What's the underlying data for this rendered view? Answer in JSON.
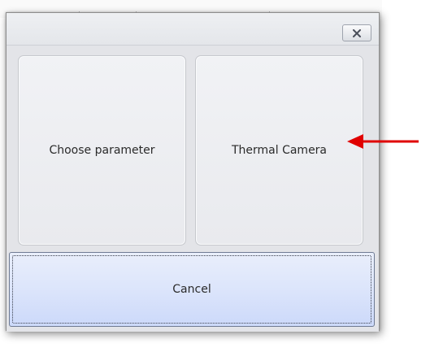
{
  "dialog": {
    "close_icon": "close-x-icon",
    "options": [
      {
        "label": "Choose parameter"
      },
      {
        "label": "Thermal Camera"
      }
    ],
    "cancel_label": "Cancel"
  },
  "annotation": {
    "arrow_color": "#e00000",
    "points_to": "Thermal Camera"
  },
  "colors": {
    "dialog_bg": "#e3e4e8",
    "cancel_bg": "#dce5fb",
    "tile_border": "#c6c8cd"
  }
}
